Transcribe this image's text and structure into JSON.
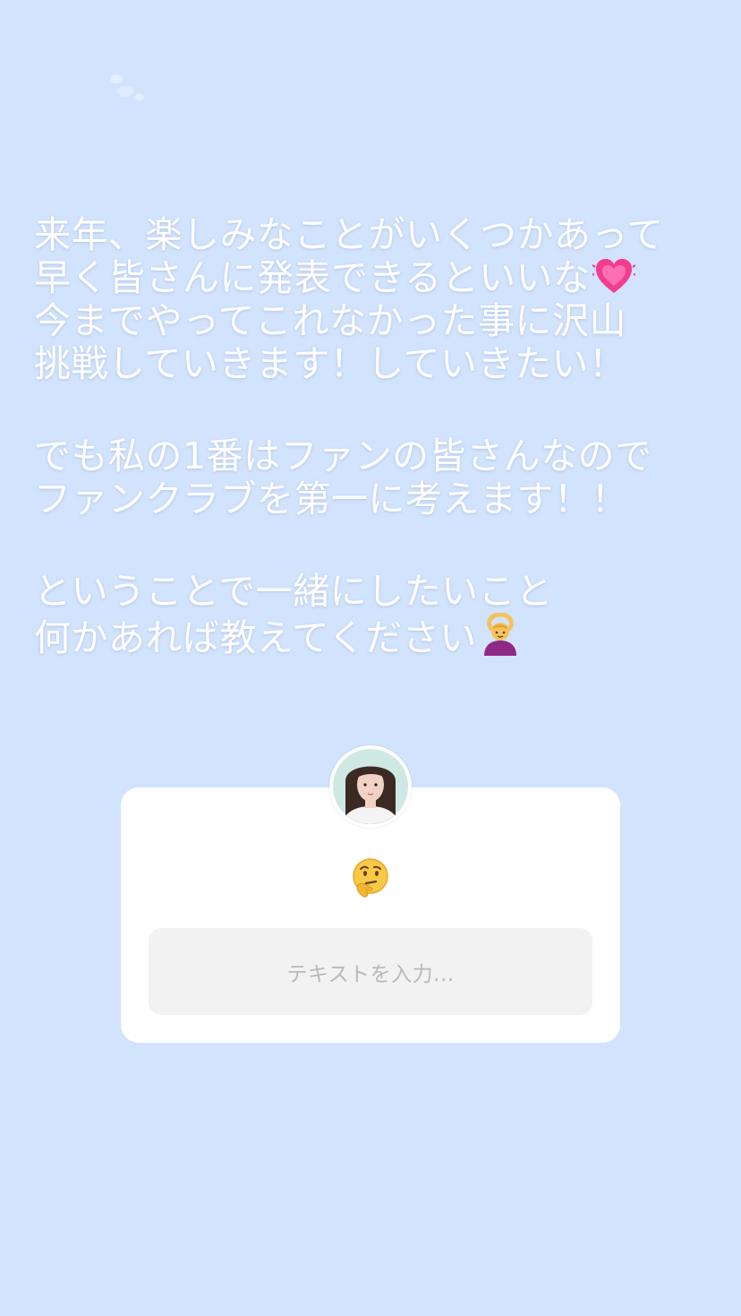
{
  "story": {
    "background": "#d2e3fd",
    "caption": {
      "lines": [
        "来年、楽しみなことがいくつかあって",
        "早く皆さんに発表できるといいな",
        "今までやってこれなかった事に沢山",
        "挑戦していきます！していきたい！",
        "でも私の1番はファンの皆さんなので",
        "ファンクラブを第一に考えます！！",
        "ということで一緒にしたいこと",
        "何かあれば教えてください"
      ],
      "emojis": {
        "line2": "growing-heart-icon",
        "line8": "person-gesturing-ok-icon"
      }
    },
    "question_sticker": {
      "avatar": "profile-avatar",
      "prompt_emoji": "thinking-face-icon",
      "input_placeholder": "テキストを入力..."
    }
  }
}
